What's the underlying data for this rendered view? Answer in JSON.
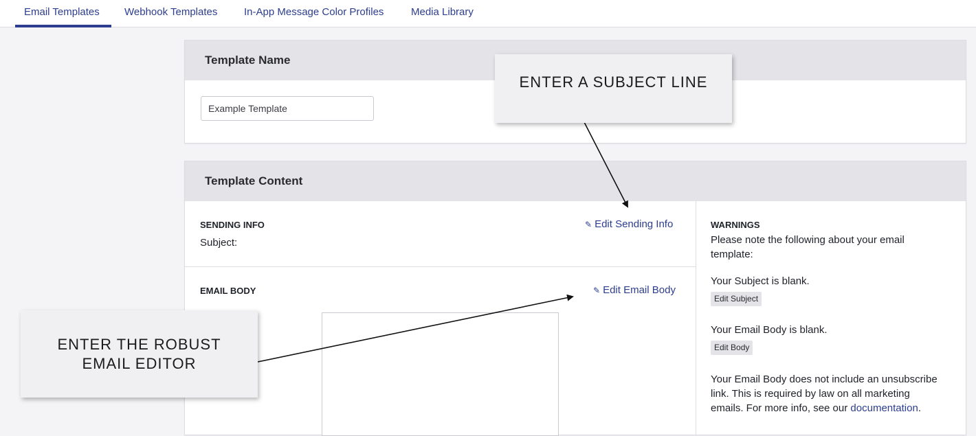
{
  "tabs": [
    {
      "label": "Email Templates",
      "active": true
    },
    {
      "label": "Webhook Templates",
      "active": false
    },
    {
      "label": "In-App Message Color Profiles",
      "active": false
    },
    {
      "label": "Media Library",
      "active": false
    }
  ],
  "template_name": {
    "title": "Template Name",
    "input_value": "Example Template"
  },
  "template_content": {
    "title": "Template Content",
    "sending_info": {
      "heading": "SENDING INFO",
      "subject_label": "Subject:",
      "edit_link": "Edit Sending Info"
    },
    "email_body": {
      "heading": "EMAIL BODY",
      "edit_link": "Edit Email Body"
    },
    "warnings": {
      "heading": "WARNINGS",
      "intro_line1": "Please note the following about your email",
      "intro_line2": "template:",
      "subject_blank": "Your Subject is blank.",
      "edit_subject": "Edit Subject",
      "body_blank": "Your Email Body is blank.",
      "edit_body": "Edit Body",
      "unsub_line1": "Your Email Body does not include an unsubscribe",
      "unsub_line2": "link. This is required by law on all marketing",
      "unsub_line3_prefix": "emails. For more info, see our",
      "unsub_link": "documentation",
      "unsub_suffix": "."
    }
  },
  "callouts": {
    "subject": "ENTER A SUBJECT LINE",
    "editor_line1": "ENTER THE ROBUST",
    "editor_line2": "EMAIL EDITOR"
  },
  "colors": {
    "accent": "#2c3d8f",
    "header_bg": "#e3e3e8"
  },
  "icons": {
    "edit": "pencil-icon"
  }
}
